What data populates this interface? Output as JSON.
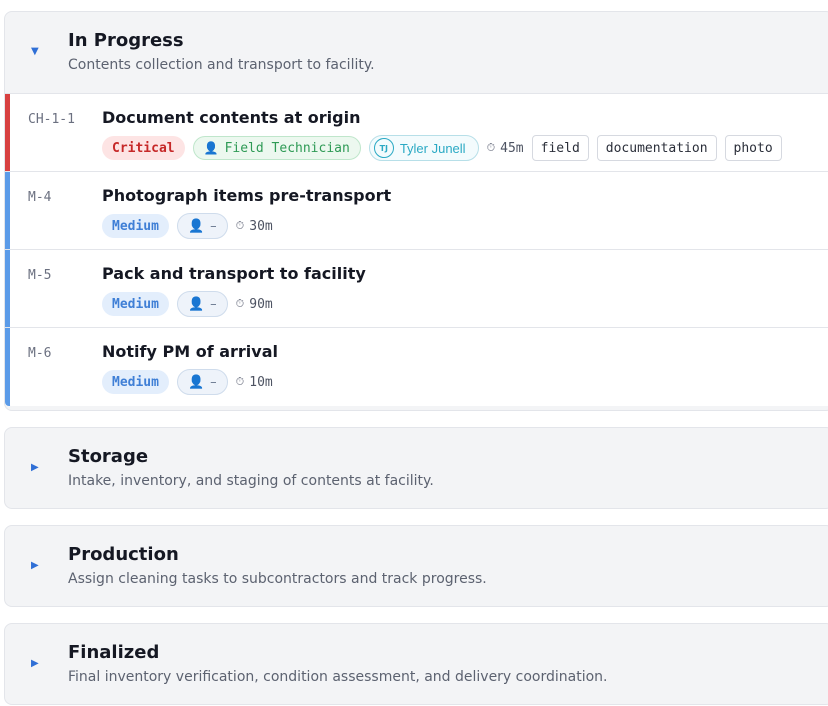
{
  "colors": {
    "critical_bar": "#d84040",
    "medium_bar": "#5b9be8",
    "chevron": "#2f6fd6"
  },
  "sections": [
    {
      "title": "In Progress",
      "description": "Contents collection and transport to facility.",
      "expanded": true,
      "chevron_icon": "caret-down-icon",
      "tasks": [
        {
          "id": "CH-1-1",
          "title": "Document contents at origin",
          "priority": "Critical",
          "role": "Field Technician",
          "assignee_initials": "TJ",
          "assignee": "Tyler Junell",
          "duration": "45m",
          "tags": [
            "field",
            "documentation",
            "photo"
          ]
        },
        {
          "id": "M-4",
          "title": "Photograph items pre-transport",
          "priority": "Medium",
          "unassigned": "–",
          "duration": "30m"
        },
        {
          "id": "M-5",
          "title": "Pack and transport to facility",
          "priority": "Medium",
          "unassigned": "–",
          "duration": "90m"
        },
        {
          "id": "M-6",
          "title": "Notify PM of arrival",
          "priority": "Medium",
          "unassigned": "–",
          "duration": "10m"
        }
      ]
    },
    {
      "title": "Storage",
      "description": "Intake, inventory, and staging of contents at facility.",
      "expanded": false,
      "chevron_icon": "caret-right-icon"
    },
    {
      "title": "Production",
      "description": "Assign cleaning tasks to subcontractors and track progress.",
      "expanded": false,
      "chevron_icon": "caret-right-icon"
    },
    {
      "title": "Finalized",
      "description": "Final inventory verification, condition assessment, and delivery coordination.",
      "expanded": false,
      "chevron_icon": "caret-right-icon"
    }
  ]
}
